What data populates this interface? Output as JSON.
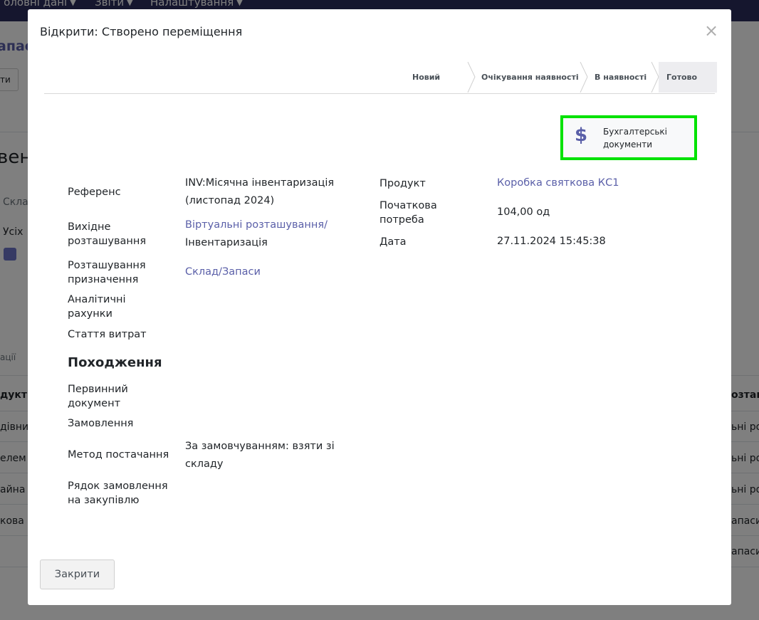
{
  "background": {
    "menu": [
      {
        "label": "Головні дані"
      },
      {
        "label": "Звіти"
      },
      {
        "label": "Налаштування"
      }
    ],
    "fragments": {
      "zapas": "апас",
      "ty": "ти",
      "ven": "вен",
      "skla": "Скла",
      "usih": "Усіх",
      "atsii": "ації",
      "dukt": "дукт",
      "rozts": "озташ",
      "row_left": [
        "дівни",
        "елем",
        "айна",
        "кова"
      ],
      "row_right": [
        "ьні ро",
        "ьні ро",
        "ьні ро",
        "апаси",
        "апаси"
      ]
    }
  },
  "modal": {
    "title": "Відкрити: Створено переміщення",
    "close_icon": "×",
    "stages": [
      {
        "label": "Новий"
      },
      {
        "label": "Очікування наявності"
      },
      {
        "label": "В наявності"
      },
      {
        "label": "Готово",
        "active": true
      }
    ],
    "accounting_button": {
      "icon": "dollar-icon",
      "icon_glyph": "$",
      "line1": "Бухгалтерські",
      "line2": "документи"
    },
    "left_fields": {
      "reference_label": "Референс",
      "reference_value_1": "INV:Місячна інвентаризація",
      "reference_value_2": "(листопад 2024)",
      "source_label_1": "Вихідне",
      "source_label_2": "розташування",
      "source_value_1": "Віртуальні розташування/",
      "source_value_2": "Інвентаризація",
      "dest_label_1": "Розташування",
      "dest_label_2": "призначення",
      "dest_value": "Склад/Запаси",
      "analytic_label_1": "Аналітичні",
      "analytic_label_2": "рахунки",
      "expense_label": "Стаття витрат"
    },
    "origin": {
      "title": "Походження",
      "primary_doc_label_1": "Первинний",
      "primary_doc_label_2": "документ",
      "order_label": "Замовлення",
      "supply_method_label": "Метод постачання",
      "supply_method_value_1": "За замовчуванням: взяти зі",
      "supply_method_value_2": "складу",
      "po_line_label_1": "Рядок замовлення",
      "po_line_label_2": "на закупівлю"
    },
    "right_fields": {
      "product_label": "Продукт",
      "product_value": "Коробка святкова КС1",
      "demand_label_1": "Початкова",
      "demand_label_2": "потреба",
      "demand_value": "104,00 од",
      "date_label": "Дата",
      "date_value": "27.11.2024 15:45:38"
    },
    "footer": {
      "close_button": "Закрити"
    }
  },
  "colors": {
    "accent": "#5a5fa8",
    "highlight": "#00e200",
    "navbar": "#2a2d5c"
  }
}
